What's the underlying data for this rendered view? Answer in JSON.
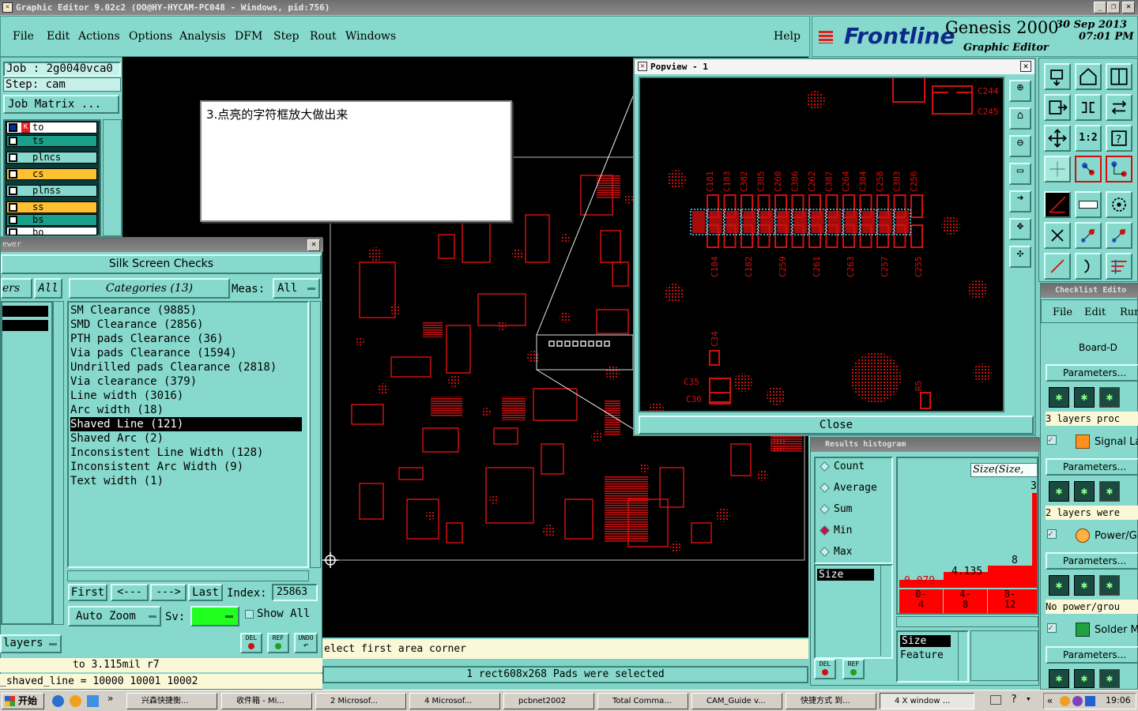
{
  "window": {
    "title": "Graphic Editor 9.02c2 (OO@HY-HYCAM-PC048 - Windows, pid:756)"
  },
  "menu": [
    "File",
    "Edit",
    "Actions",
    "Options",
    "Analysis",
    "DFM",
    "Step",
    "Rout",
    "Windows"
  ],
  "menu_help": "Help",
  "brand": {
    "logo": "Frontline",
    "product": "Genesis 2000",
    "subtitle": "Graphic Editor",
    "date": "30 Sep 2013",
    "time": "07:01 PM"
  },
  "job": {
    "job": "Job : 2g0040vca0",
    "step": "Step: cam",
    "matrix_button": "Job Matrix ..."
  },
  "layers": [
    "to",
    "ts",
    "plncs",
    "cs",
    "plnss",
    "ss",
    "bs",
    "bo"
  ],
  "annotation": {
    "text": "3.点亮的字符框放大做出来"
  },
  "viewer": {
    "title": "ewer",
    "header": "Silk Screen Checks",
    "layers_label": "ers",
    "all_left": "All",
    "categories": "Categories (13)",
    "meas_label": "Meas:",
    "meas_value": "All",
    "items": [
      "SM Clearance (9885)",
      "SMD Clearance (2856)",
      "PTH pads Clearance (36)",
      "Via pads Clearance (1594)",
      "Undrilled pads Clearance (2818)",
      "Via clearance (379)",
      "Line width (3016)",
      "Arc width (18)",
      "Shaved Line (121)",
      "Shaved Arc (2)",
      "Inconsistent Line Width (128)",
      "Inconsistent Arc Width (9)",
      "Text width (1)"
    ],
    "selected_index": 8,
    "nav": {
      "first": "First",
      "prev": "<---",
      "next": "--->",
      "last": "Last",
      "index_label": "Index:",
      "index_value": "25863"
    },
    "auto_zoom": "Auto Zoom",
    "sv_label": "Sv:",
    "show_all": "Show All",
    "layers_btn": "layers",
    "del": "DEL",
    "ref": "REF",
    "undo": "UNDO",
    "status1": "to 3.115mil r7",
    "status2": "_shaved_line = 10000 10001 10002"
  },
  "popview": {
    "title": "Popview - 1",
    "close": "Close",
    "labels_top": [
      "C181",
      "C183",
      "C382",
      "C385",
      "C260",
      "C386",
      "C262",
      "C387",
      "C264",
      "C384",
      "C258",
      "C383",
      "C256"
    ],
    "labels_bottom": [
      "C184",
      "C182",
      "C259",
      "C261",
      "C263",
      "C257",
      "C255"
    ],
    "misc_labels": [
      "C244",
      "C245",
      "C34",
      "C35",
      "C36",
      "R5"
    ]
  },
  "status": {
    "prompt": "elect first area corner",
    "selection": "1 rect608x268 Pads were selected"
  },
  "histogram": {
    "title": "Results histogram",
    "options": [
      "Count",
      "Average",
      "Sum",
      "Min",
      "Max"
    ],
    "selected": "Min",
    "list_header": "Size",
    "size_box": "Size(Size,",
    "values": [
      "0.079",
      "4.135",
      "8",
      "3"
    ],
    "bins": [
      "0-\n4",
      "4-\n8",
      "8-\n12"
    ],
    "bins_text": [
      "0-4",
      "4-8",
      "8-12"
    ],
    "fields": [
      "Size",
      "Feature"
    ],
    "del": "DEL",
    "ref": "REF"
  },
  "checklist": {
    "title": "Checklist Edito",
    "menu": [
      "File",
      "Edit",
      "Run"
    ],
    "rows": [
      "Board-D",
      "Parameters...",
      "3 layers proc",
      "Signal La",
      "Parameters...",
      "2 layers were",
      "Power/Gr",
      "Parameters...",
      "No power/grou",
      "Solder M",
      "Parameters..."
    ]
  },
  "taskbar": {
    "start": "开始",
    "tasks": [
      "兴森快捷衡...",
      "收件箱 - Mi...",
      "2 Microsof...",
      "4 Microsof...",
      "pcbnet2002",
      "Total Comma...",
      "CAM_Guide v...",
      "快捷方式 到...",
      "4 X window ..."
    ],
    "clock": "19:06"
  },
  "colors": {
    "teal": "#86d9cc",
    "pcb_red": "#d01010",
    "cyan_highlight": "#5fe0ff",
    "bar_red": "#ff0000"
  }
}
